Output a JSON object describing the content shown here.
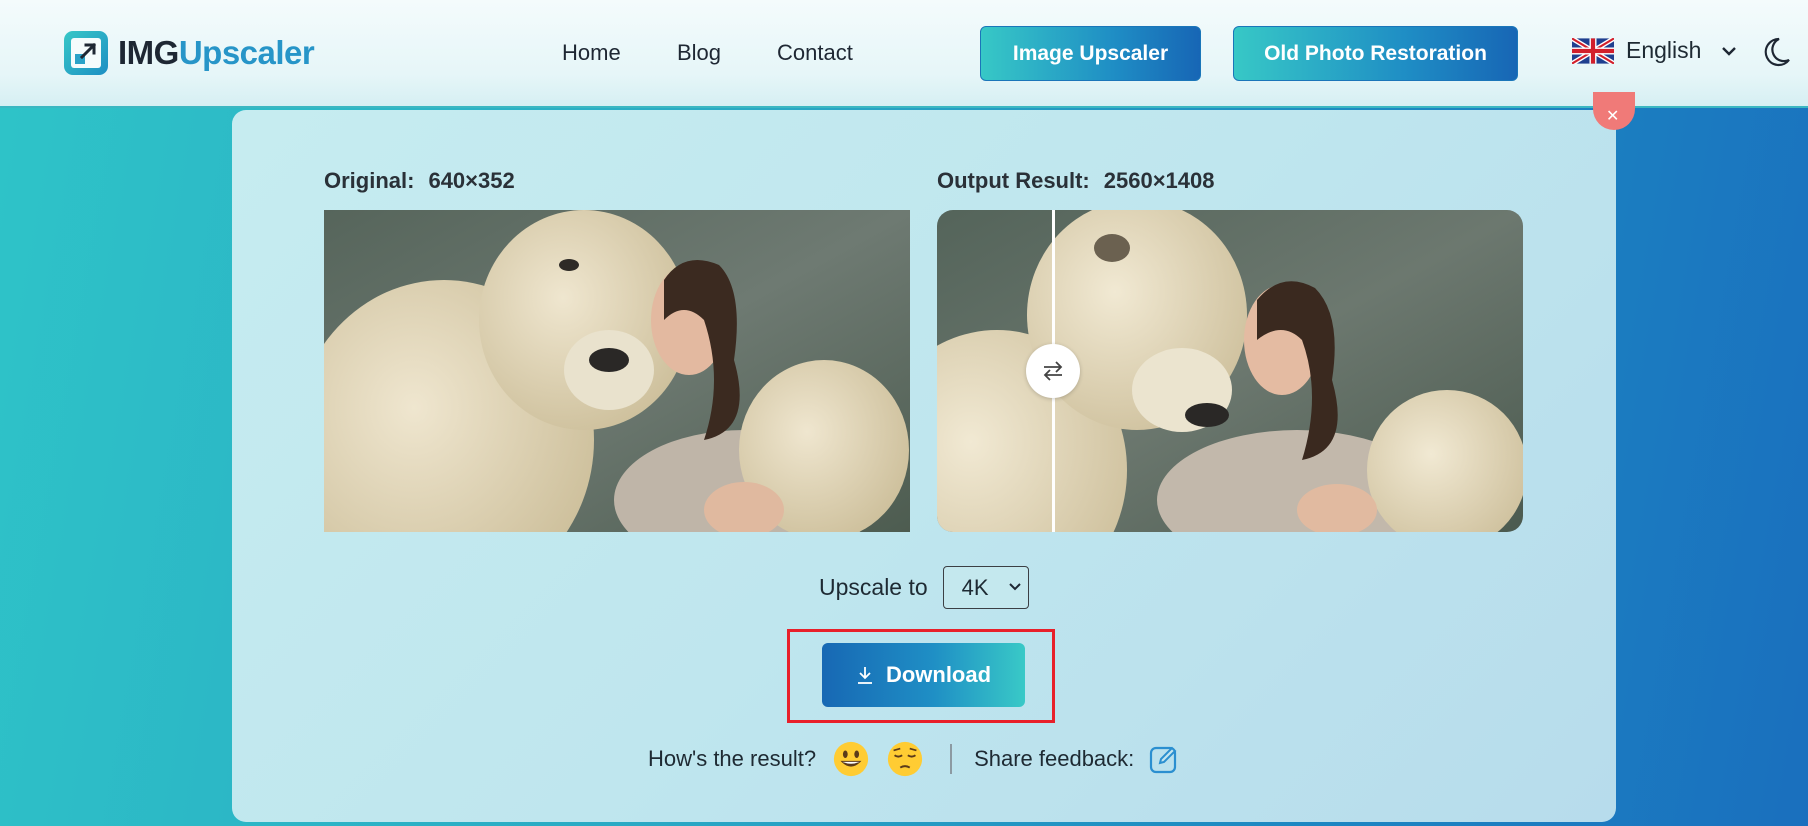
{
  "header": {
    "logo_part1": "IMG",
    "logo_part2": "Upscaler",
    "nav": [
      "Home",
      "Blog",
      "Contact"
    ],
    "btn_image_upscaler": "Image Upscaler",
    "btn_old_photo": "Old Photo Restoration",
    "language": "English"
  },
  "comparison": {
    "original_label": "Original:",
    "original_size": "640×352",
    "output_label": "Output Result:",
    "output_size": "2560×1408"
  },
  "controls": {
    "upscale_label": "Upscale to",
    "upscale_value": "4K",
    "download_label": "Download"
  },
  "feedback": {
    "question": "How's the result?",
    "share_label": "Share feedback:"
  },
  "colors": {
    "accent_teal": "#37c8c6",
    "accent_blue": "#1766b5",
    "highlight_red": "#e8202a",
    "close_red": "#f07a78"
  },
  "icons": [
    "logo-icon",
    "uk-flag-icon",
    "chevron-down-icon",
    "moon-icon",
    "close-icon",
    "swap-icon",
    "download-icon",
    "smile-emoji-icon",
    "pensive-emoji-icon",
    "edit-icon"
  ]
}
